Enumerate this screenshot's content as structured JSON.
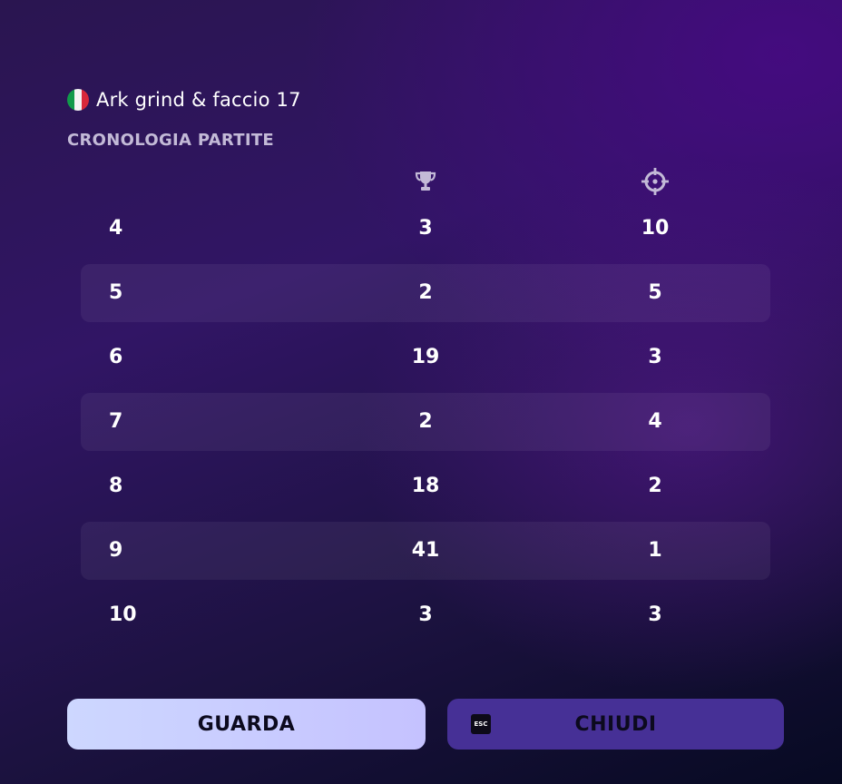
{
  "header": {
    "title": "Ark grind & faccio 17",
    "flag_icon": "italy-flag-icon"
  },
  "section": {
    "title": "CRONOLOGIA PARTITE"
  },
  "columns": [
    {
      "icon": "trophy-icon"
    },
    {
      "icon": "crosshair-icon"
    }
  ],
  "rows": [
    {
      "match": "4",
      "placement": "3",
      "eliminations": "10"
    },
    {
      "match": "5",
      "placement": "2",
      "eliminations": "5"
    },
    {
      "match": "6",
      "placement": "19",
      "eliminations": "3"
    },
    {
      "match": "7",
      "placement": "2",
      "eliminations": "4"
    },
    {
      "match": "8",
      "placement": "18",
      "eliminations": "2"
    },
    {
      "match": "9",
      "placement": "41",
      "eliminations": "1"
    },
    {
      "match": "10",
      "placement": "3",
      "eliminations": "3"
    }
  ],
  "buttons": {
    "watch_label": "GUARDA",
    "close_label": "CHIUDI",
    "close_key": "ESC"
  },
  "colors": {
    "accent_watch": "#c9ccff",
    "accent_close": "#463096",
    "muted_text": "#c3bad7"
  }
}
